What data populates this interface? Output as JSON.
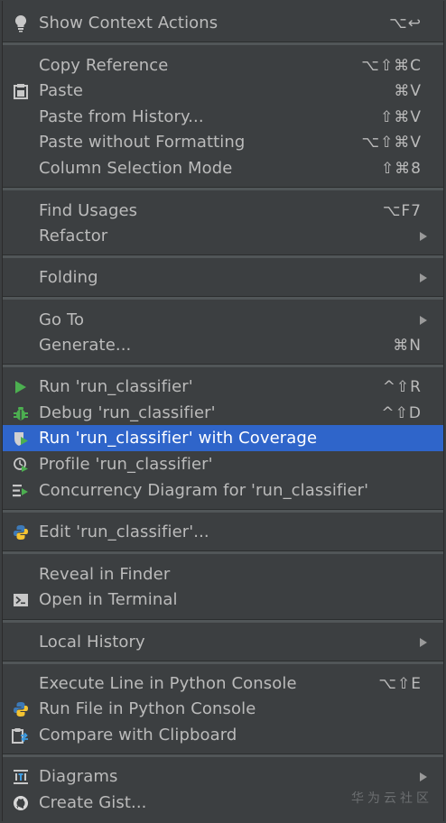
{
  "menu": {
    "show_context_actions": {
      "label": "Show Context Actions",
      "shortcut": "⌥↩"
    },
    "copy_reference": {
      "label": "Copy Reference",
      "shortcut": "⌥⇧⌘C"
    },
    "paste": {
      "label": "Paste",
      "shortcut": "⌘V"
    },
    "paste_from_history": {
      "label": "Paste from History...",
      "shortcut": "⇧⌘V"
    },
    "paste_without_formatting": {
      "label": "Paste without Formatting",
      "shortcut": "⌥⇧⌘V"
    },
    "column_selection_mode": {
      "label": "Column Selection Mode",
      "shortcut": "⇧⌘8"
    },
    "find_usages": {
      "label": "Find Usages",
      "shortcut": "⌥F7"
    },
    "refactor": {
      "label": "Refactor"
    },
    "folding": {
      "label": "Folding"
    },
    "go_to": {
      "label": "Go To"
    },
    "generate": {
      "label": "Generate...",
      "shortcut": "⌘N"
    },
    "run": {
      "label": "Run 'run_classifier'",
      "shortcut": "^⇧R"
    },
    "debug": {
      "label": "Debug 'run_classifier'",
      "shortcut": "^⇧D"
    },
    "run_coverage": {
      "label": "Run 'run_classifier' with Coverage"
    },
    "profile": {
      "label": "Profile 'run_classifier'"
    },
    "concurrency": {
      "label": "Concurrency Diagram for 'run_classifier'"
    },
    "edit_config": {
      "label": "Edit 'run_classifier'..."
    },
    "reveal_in_finder": {
      "label": "Reveal in Finder"
    },
    "open_in_terminal": {
      "label": "Open in Terminal"
    },
    "local_history": {
      "label": "Local History"
    },
    "execute_line": {
      "label": "Execute Line in Python Console",
      "shortcut": "⌥⇧E"
    },
    "run_file_console": {
      "label": "Run File in Python Console"
    },
    "compare_clipboard": {
      "label": "Compare with Clipboard"
    },
    "diagrams": {
      "label": "Diagrams"
    },
    "create_gist": {
      "label": "Create Gist..."
    }
  },
  "watermark": "华为云社区",
  "colors": {
    "background": "#3c3f41",
    "text": "#bbbbbb",
    "highlight": "#2f65ca",
    "run_green": "#4caf50",
    "python_blue": "#3d7ab8",
    "python_yellow": "#f5c432"
  }
}
